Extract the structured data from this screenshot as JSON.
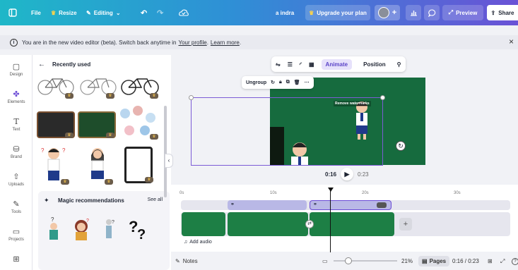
{
  "topbar": {
    "file_label": "File",
    "resize_label": "Resize",
    "editing_label": "Editing",
    "user_name": "a indra",
    "upgrade_label": "Upgrade your plan",
    "preview_label": "Preview",
    "share_label": "Share"
  },
  "infobar": {
    "message": "You are in the new video editor (beta). Switch back anytime in",
    "profile_link": "Your profile",
    "learn_more": "Learn more",
    "suffix": "."
  },
  "sidebar": {
    "items": [
      {
        "label": "Design",
        "icon": "design-icon"
      },
      {
        "label": "Elements",
        "icon": "elements-icon"
      },
      {
        "label": "Text",
        "icon": "text-icon"
      },
      {
        "label": "Brand",
        "icon": "brand-icon"
      },
      {
        "label": "Uploads",
        "icon": "uploads-icon"
      },
      {
        "label": "Tools",
        "icon": "tools-icon"
      },
      {
        "label": "Projects",
        "icon": "projects-icon"
      }
    ],
    "accent": "#6b4bd6"
  },
  "panel": {
    "title": "Recently used",
    "magic_title": "Magic recommendations",
    "see_all": "See all"
  },
  "context_toolbar": {
    "animate_label": "Animate",
    "position_label": "Position"
  },
  "ungroup_toolbar": {
    "ungroup_label": "Ungroup"
  },
  "canvas": {
    "watermark_text": "Remove watermarks",
    "background": "#166b3e"
  },
  "player": {
    "current_time": "0:16",
    "total_time": "0:23"
  },
  "timeline": {
    "ticks": [
      "0s",
      "10s",
      "20s",
      "30s"
    ],
    "add_audio_label": "Add audio"
  },
  "bottombar": {
    "notes_label": "Notes",
    "zoom_value": "21%",
    "pages_label": "Pages",
    "time_readout": "0:16 / 0:23"
  }
}
